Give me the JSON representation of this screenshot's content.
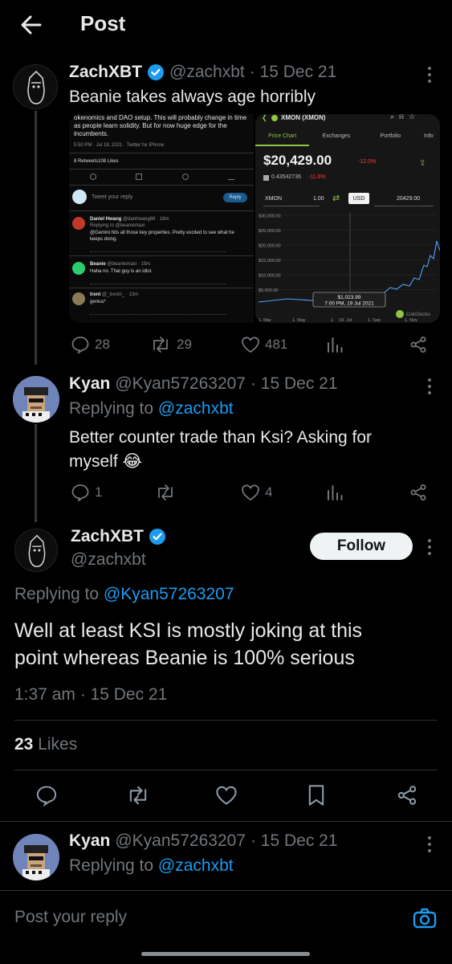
{
  "header": {
    "title": "Post"
  },
  "tweet1": {
    "name": "ZachXBT",
    "handle": "@zachxbt",
    "date": "· 15 Dec 21",
    "text": "Beanie takes always age horribly",
    "stats": {
      "replies": "28",
      "retweets": "29",
      "likes": "481"
    },
    "media": {
      "left": {
        "tweet_text": "okenomics and DAO setup. This will probably change in time as people learn solidity. But for now huge edge for the incumbents.",
        "tweet_meta": "5:50 PM · Jul 18, 2021 · Twitter for iPhone",
        "retweets": "8 Retweets",
        "likes": "108 Likes",
        "reply_placeholder": "Tweet your reply",
        "reply_button": "Reply",
        "replies": [
          {
            "name": "Daniel Hwang",
            "handle": "@danhwang88 · 16m",
            "replying": "Replying to @beaniemaxi",
            "text": "@Gemini hits all those key properties. Pretty excited to see what he keeps doing."
          },
          {
            "name": "Beanie",
            "handle": "@beaniemaxi · 15m",
            "text": "Haha no. That guy is an idiot."
          },
          {
            "name": "trent",
            "handle": "@_trentn_ · 13m",
            "text": "genius*"
          }
        ]
      },
      "right": {
        "title": "XMON (XMON)",
        "tabs": [
          "Price Chart",
          "Exchanges",
          "Portfolio",
          "Info"
        ],
        "price": "$20,429.00",
        "change": "-12.0%",
        "btc_price": "0.43542736",
        "btc_change": "-11.6%",
        "convert_from": "XMON",
        "convert_amount": "1.00",
        "convert_currency": "USD",
        "convert_result": "20429.00",
        "yticks": [
          "$30,000.00",
          "$25,000.00",
          "$20,000.00",
          "$15,000.00",
          "$10,000.00",
          "$5,000.00"
        ],
        "xticks": [
          "1. Mar",
          "1. May",
          "1.",
          "19. Jul",
          "1. Sep",
          "1. Nov"
        ],
        "tooltip_value": "$1,023.99",
        "tooltip_date": "7:00 PM, 19 Jul 2021",
        "watermark": "CoinGecko",
        "colors": {
          "accent": "#8dc63f",
          "negative": "#ff3a33"
        }
      }
    }
  },
  "tweet2": {
    "name": "Kyan",
    "handle": "@Kyan57263207",
    "date": "· 15 Dec 21",
    "replying_prefix": "Replying to ",
    "replying_to": "@zachxbt",
    "text_line1": "Better counter trade than Ksi? Asking for",
    "text_line2": "myself 😂",
    "stats": {
      "replies": "1",
      "retweets": "",
      "likes": "4"
    }
  },
  "main_tweet": {
    "name": "ZachXBT",
    "handle": "@zachxbt",
    "follow_label": "Follow",
    "replying_prefix": "Replying to ",
    "replying_to": "@Kyan57263207",
    "text_line1": "Well at least KSI is mostly joking at this",
    "text_line2": "point whereas Beanie is 100% serious",
    "timestamp": "1:37 am · 15 Dec 21",
    "likes_count": "23",
    "likes_label": "Likes"
  },
  "tweet3": {
    "name": "Kyan",
    "handle": "@Kyan57263207",
    "date": "· 15 Dec 21",
    "replying_prefix": "Replying to ",
    "replying_to": "@zachxbt"
  },
  "reply_bar": {
    "placeholder": "Post your reply"
  },
  "colors": {
    "accent": "#1d9bf0",
    "background": "#000000",
    "muted": "#71767b"
  }
}
